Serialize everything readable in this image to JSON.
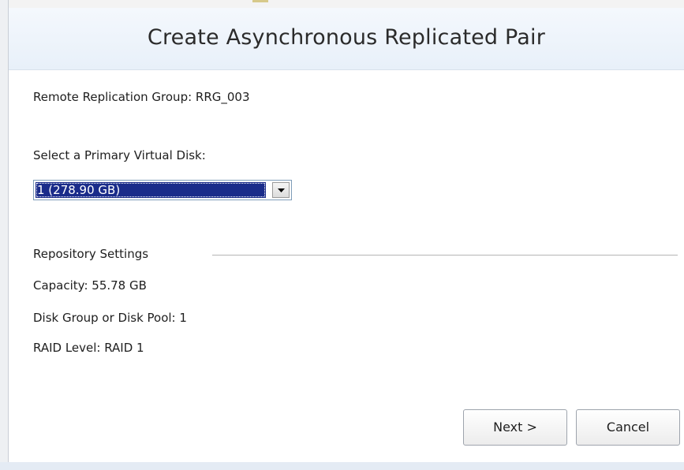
{
  "dialog": {
    "title": "Create Asynchronous Replicated Pair",
    "remote_group_label": "Remote Replication Group: RRG_003",
    "select_label": "Select a Primary Virtual Disk:",
    "primary_disk": {
      "selected": "1 (278.90 GB)"
    },
    "repository": {
      "heading": "Repository Settings",
      "capacity": "Capacity:  55.78 GB",
      "disk_group": "Disk Group or Disk Pool:  1",
      "raid_level": "RAID Level:  RAID 1"
    },
    "buttons": {
      "next": "Next >",
      "cancel": "Cancel"
    }
  },
  "colors": {
    "selection": "#1a2c8a",
    "header_bg": "#e8f0f9"
  },
  "icons": {
    "dropdown": "chevron-down-icon"
  }
}
